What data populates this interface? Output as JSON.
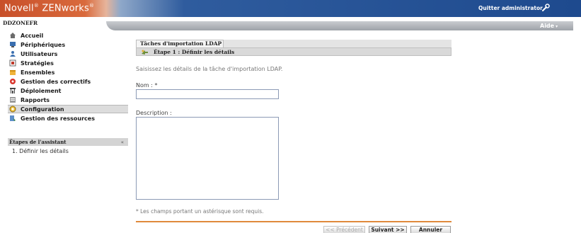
{
  "header": {
    "logo": "Novell",
    "logo_reg": "®",
    "logo_product": " ZENworks",
    "logo_reg2": "®",
    "quit_label": "Quitter administrator",
    "zone": "DDZONEFR",
    "help_label": "Aide",
    "help_caret": "▾"
  },
  "sidebar": {
    "items": [
      {
        "label": "Accueil",
        "icon": "home-icon"
      },
      {
        "label": "Périphériques",
        "icon": "devices-icon"
      },
      {
        "label": "Utilisateurs",
        "icon": "users-icon"
      },
      {
        "label": "Stratégies",
        "icon": "policies-icon"
      },
      {
        "label": "Ensembles",
        "icon": "bundles-icon"
      },
      {
        "label": "Gestion des correctifs",
        "icon": "patch-icon"
      },
      {
        "label": "Déploiement",
        "icon": "deployment-icon"
      },
      {
        "label": "Rapports",
        "icon": "reports-icon"
      },
      {
        "label": "Configuration",
        "icon": "configuration-icon"
      },
      {
        "label": "Gestion des ressources",
        "icon": "asset-icon"
      }
    ],
    "active_item": "Configuration",
    "wizard_header": "Étapes de l'assistant",
    "wizard_collapse": "«",
    "wizard_step": "1. Définir les détails"
  },
  "main": {
    "task_title": "Tâches d'importation LDAP",
    "step_title": "Étape 1 : Définir les détails",
    "intro": "Saisissez les détails de la tâche d'importation LDAP.",
    "name_label": "Nom : *",
    "name_value": "",
    "description_label": "Description :",
    "description_value": "",
    "required_note": "* Les champs portant un astérisque sont requis."
  },
  "buttons": {
    "previous": "<< Précédent",
    "next": "Suivant >>",
    "cancel": "Annuler"
  },
  "colors": {
    "header_orange": "#c8502a",
    "header_blue": "#1e4a8e",
    "divider_orange": "#e08a3c",
    "active_nav_bg": "#dcdcdc"
  }
}
